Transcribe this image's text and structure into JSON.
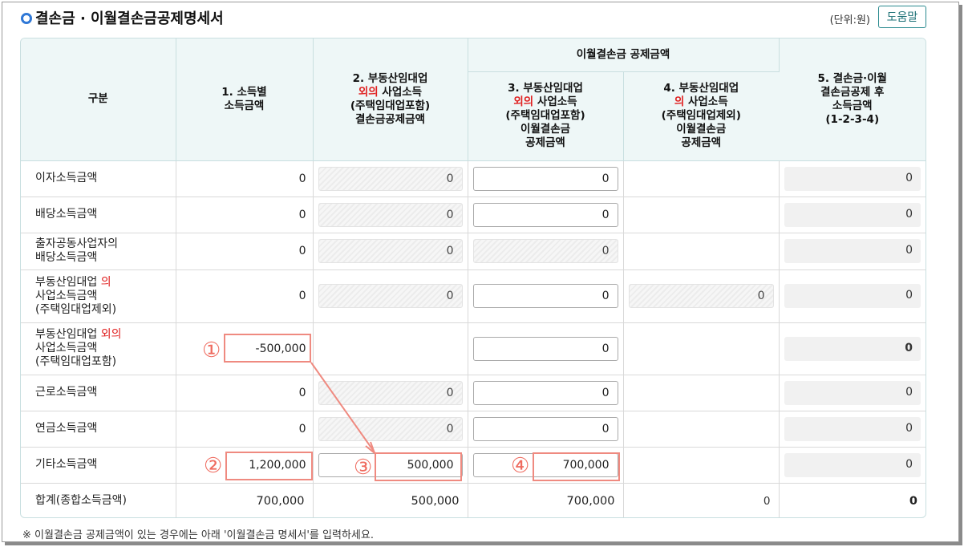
{
  "header": {
    "title": "결손금 · 이월결손금공제명세서",
    "unit": "(단위:원)",
    "help_button": "도움말"
  },
  "table": {
    "col_category": "구분",
    "col1": "1. 소득별\n소득금액",
    "col2_a": "2. 부동산임대업",
    "col2_b_red": "외의",
    "col2_b": " 사업소득",
    "col2_c": "(주택임대업포함)\n결손금공제금액",
    "group_header": "이월결손금 공제금액",
    "col3_a": "3. 부동산임대업",
    "col3_b_red": "외의",
    "col3_b": " 사업소득",
    "col3_c": "(주택임대업포함)\n이월결손금\n공제금액",
    "col4_a": "4. 부동산임대업",
    "col4_b_red": "의",
    "col4_b": " 사업소득",
    "col4_c": "(주택임대업제외)\n이월결손금\n공제금액",
    "col5": "5. 결손금·이월\n결손금공제 후\n소득금액\n(1-2-3-4)",
    "rows": [
      {
        "label": "이자소득금액",
        "c1": "0",
        "c2": "0",
        "c3": "0",
        "c5": "0"
      },
      {
        "label": "배당소득금액",
        "c1": "0",
        "c2": "0",
        "c3": "0",
        "c5": "0"
      },
      {
        "label_1": "출자공동사업자의",
        "label_2": "배당소득금액",
        "c1": "0",
        "c2": "0",
        "c3": "0",
        "c5": "0"
      },
      {
        "label_1a": "부동산임대업 ",
        "label_1red": "의",
        "label_2": "사업소득금액",
        "label_3": "(주택임대업제외)",
        "c1": "0",
        "c2": "0",
        "c3": "0",
        "c4": "0",
        "c5": "0"
      },
      {
        "label_1a": "부동산임대업 ",
        "label_1red": "외의",
        "label_2": "사업소득금액",
        "label_3": "(주택임대업포함)",
        "c1": "-500,000",
        "c3": "0",
        "c5": "0"
      },
      {
        "label": "근로소득금액",
        "c1": "0",
        "c2": "0",
        "c3": "0",
        "c5": "0"
      },
      {
        "label": "연금소득금액",
        "c1": "0",
        "c2": "0",
        "c3": "0",
        "c5": "0"
      },
      {
        "label": "기타소득금액",
        "c1": "1,200,000",
        "c2": "500,000",
        "c3": "700,000",
        "c5": "0"
      },
      {
        "label": "합계(종합소득금액)",
        "c1": "700,000",
        "c2": "500,000",
        "c3": "700,000",
        "c4": "0",
        "c5": "0"
      }
    ]
  },
  "annotations": {
    "n1": "①",
    "n2": "②",
    "n3": "③",
    "n4": "④"
  },
  "note": "※ 이월결손금 공제금액이 있는 경우에는 아래 '이월결손금 명세서'를 입력하세요.",
  "colors": {
    "accent": "#2f78d6",
    "highlight": "#ef6b5f",
    "header_bg": "#eef7f7",
    "help_border": "#2a8a8f"
  }
}
